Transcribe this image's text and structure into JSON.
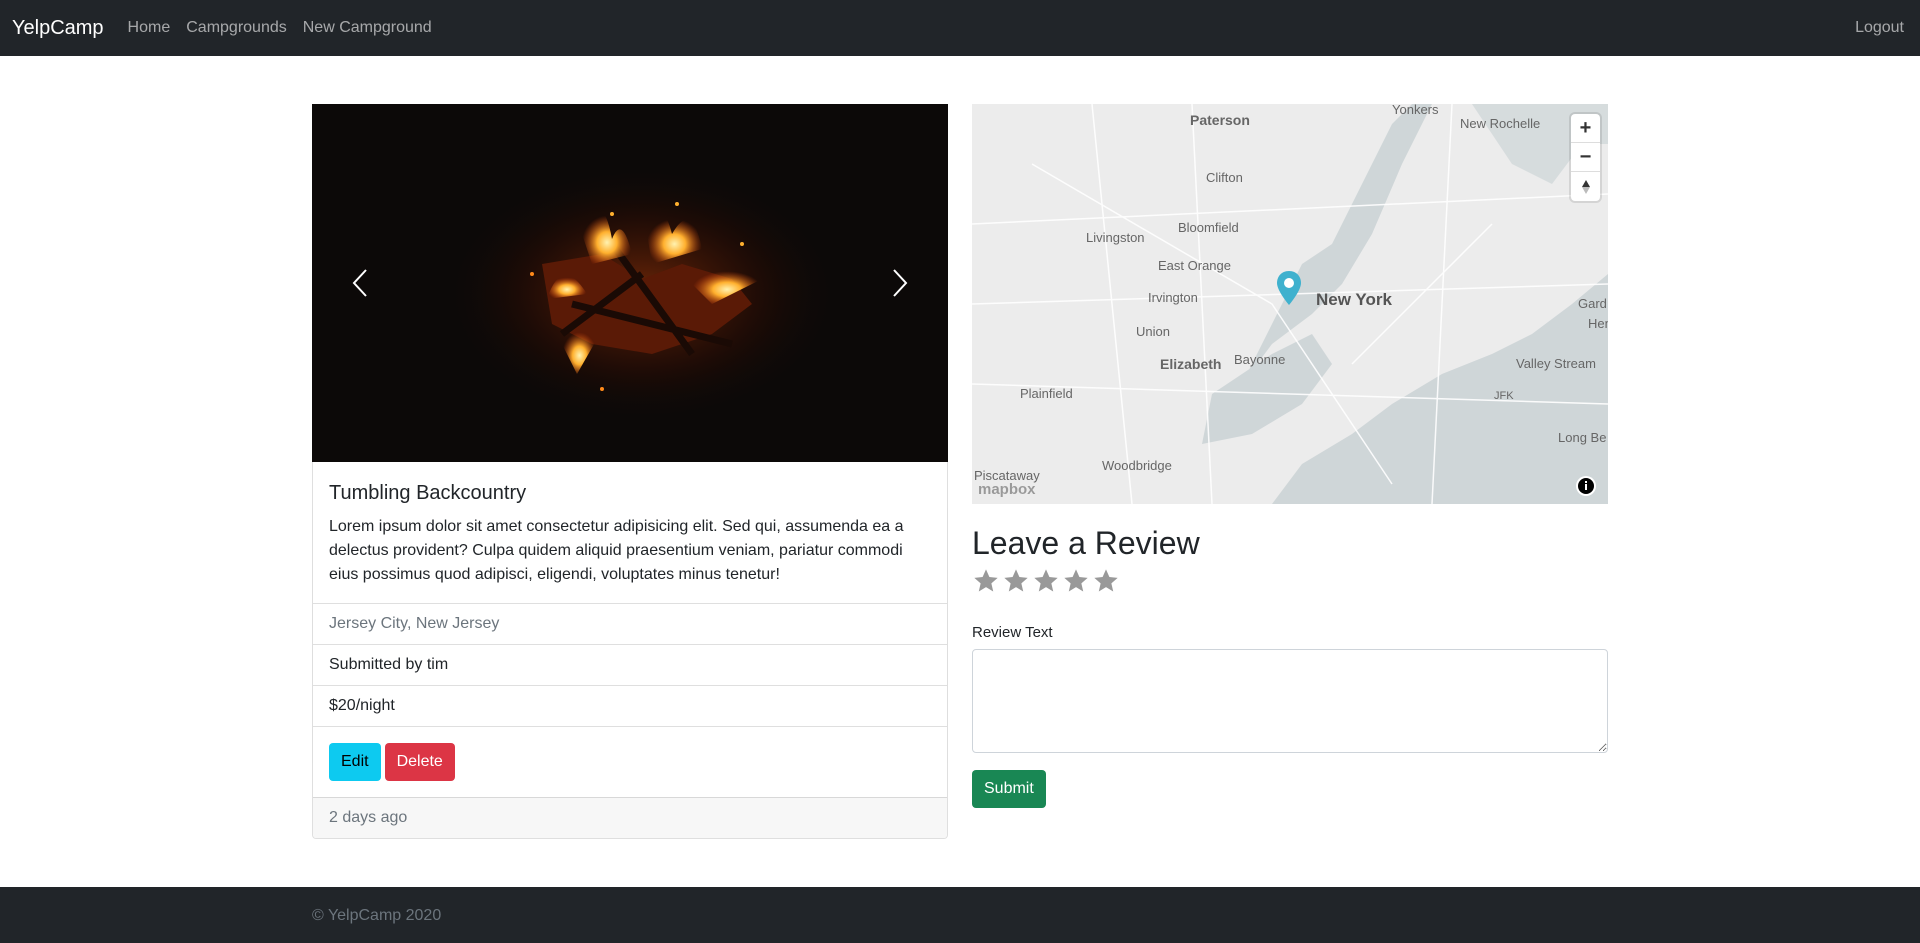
{
  "navbar": {
    "brand": "YelpCamp",
    "links": [
      "Home",
      "Campgrounds",
      "New Campground"
    ],
    "logout": "Logout"
  },
  "campground": {
    "title": "Tumbling Backcountry",
    "description": "Lorem ipsum dolor sit amet consectetur adipisicing elit. Sed qui, assumenda ea a delectus provident? Culpa quidem aliquid praesentium veniam, pariatur commodi eius possimus quod adipisci, eligendi, voluptates minus tenetur!",
    "location": "Jersey City, New Jersey",
    "submitted_by": "Submitted by tim",
    "price": "$20/night",
    "edit_label": "Edit",
    "delete_label": "Delete",
    "posted": "2 days ago"
  },
  "map": {
    "labels": {
      "yonkers": "Yonkers",
      "paterson": "Paterson",
      "new_rochelle": "New Rochelle",
      "clifton": "Clifton",
      "livingston": "Livingston",
      "bloomfield": "Bloomfield",
      "east_orange": "East Orange",
      "irvington": "Irvington",
      "new_york": "New York",
      "union": "Union",
      "elizabeth": "Elizabeth",
      "bayonne": "Bayonne",
      "valley_stream": "Valley Stream",
      "plainfield": "Plainfield",
      "jfk": "JFK",
      "woodbridge": "Woodbridge",
      "gard": "Gard",
      "hen": "Hen",
      "long_be": "Long Be",
      "piscataway": "Piscataway"
    },
    "zoom_in": "+",
    "zoom_out": "−",
    "logo": "mapbox",
    "pin_color": "#3fb1ce"
  },
  "review": {
    "heading": "Leave a Review",
    "rating_max": 5,
    "text_label": "Review Text",
    "text_value": "",
    "submit_label": "Submit"
  },
  "footer": {
    "copyright": "© YelpCamp 2020"
  }
}
